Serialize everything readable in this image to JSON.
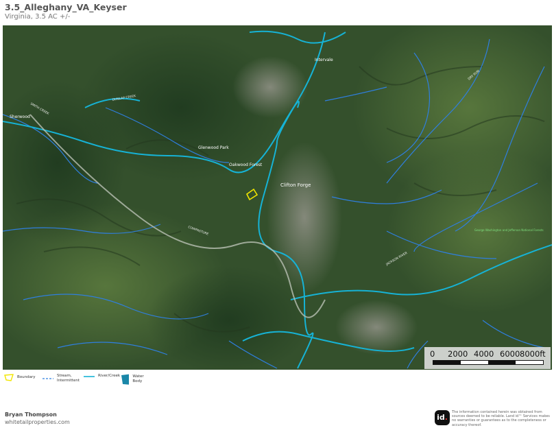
{
  "header": {
    "title": "3.5_Alleghany_VA_Keyser",
    "subtitle": "Virginia, 3.5 AC +/-"
  },
  "map": {
    "places": [
      {
        "name": "Oakwood Forest",
        "kind": "locality"
      },
      {
        "name": "Sherwood",
        "kind": "locality"
      },
      {
        "name": "Clifton Forge",
        "kind": "town"
      },
      {
        "name": "Glenwood Park",
        "kind": "locality"
      },
      {
        "name": "Intervale",
        "kind": "locality"
      },
      {
        "name": "George Washington and Jefferson National Forests",
        "kind": "park"
      }
    ],
    "roads": [
      "DUNLAP CREEK",
      "SMITH CREEK",
      "JACKSON RIVER",
      "COWPASTURE",
      "DRY RUN"
    ],
    "colors": {
      "boundary": "#f2e600",
      "stream": "#2f7fe0",
      "river": "#16b3d6",
      "water_body": "#1a87a8",
      "label_white": "#ffffff"
    }
  },
  "scale_bar": {
    "labels": [
      "0",
      "2000",
      "4000",
      "6000",
      "8000ft"
    ]
  },
  "legend": {
    "items": [
      {
        "label": "Boundary",
        "icon": "boundary-icon"
      },
      {
        "label": "Stream, Intermittent",
        "icon": "stream-intermittent-icon"
      },
      {
        "label": "River/Creek",
        "icon": "river-creek-icon"
      },
      {
        "label": "Water Body",
        "icon": "water-body-icon"
      }
    ]
  },
  "footer": {
    "author": "Bryan Thompson",
    "website": "whitetailproperties.com",
    "logo_text": "id",
    "disclaimer": "The information contained herein was obtained from sources deemed to be reliable. Land id™ Services makes no warranties or guarantees as to the completeness or accuracy thereof."
  }
}
